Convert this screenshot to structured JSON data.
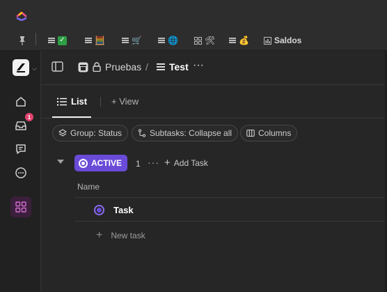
{
  "titlebar": {
    "logo_icon": "clickup-logo-icon"
  },
  "bookmarks": {
    "items": [
      {
        "emoji": "✅"
      },
      {
        "emoji": "🧮"
      },
      {
        "emoji": "🛒"
      },
      {
        "emoji": "🌐"
      },
      {
        "emoji": "🛠"
      },
      {
        "emoji": "💰"
      },
      {
        "label": "Saldos"
      }
    ]
  },
  "sidebar": {
    "notification_badge": "1"
  },
  "header": {
    "space": "Pruebas",
    "separator": "/",
    "list": "Test",
    "more": "···"
  },
  "tabs": {
    "list_label": "List",
    "view_label": "+ View"
  },
  "chips": {
    "group": "Group: Status",
    "subtasks": "Subtasks: Collapse all",
    "columns": "Columns"
  },
  "group": {
    "status": "ACTIVE",
    "count": "1",
    "more": "···",
    "add_task": "Add Task",
    "status_color": "#6a4bd8"
  },
  "table": {
    "column_name": "Name",
    "tasks": [
      {
        "name": "Task"
      }
    ],
    "new_task": "New task"
  }
}
